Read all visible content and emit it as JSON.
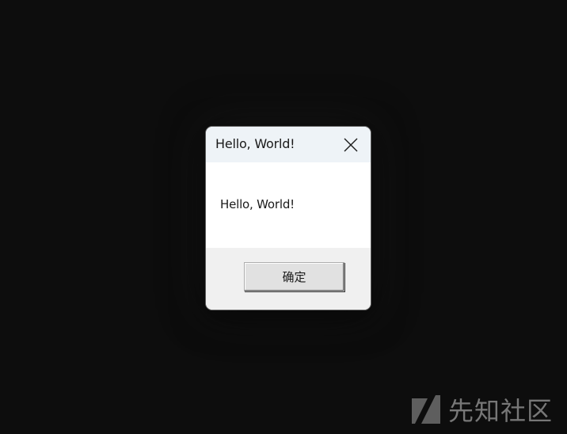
{
  "dialog": {
    "title": "Hello, World!",
    "message": "Hello, World!",
    "ok_label": "确定",
    "close_icon": "close-icon"
  },
  "watermark": {
    "text": "先知社区",
    "logo_icon": "xianzhi-logo-icon"
  },
  "colors": {
    "desktop_background": "#0d0d0d",
    "titlebar_background": "#eef3f7",
    "content_background": "#ffffff",
    "footer_background": "#f0f0f0",
    "button_background": "#e1e1e1",
    "watermark_color": "#777777"
  }
}
